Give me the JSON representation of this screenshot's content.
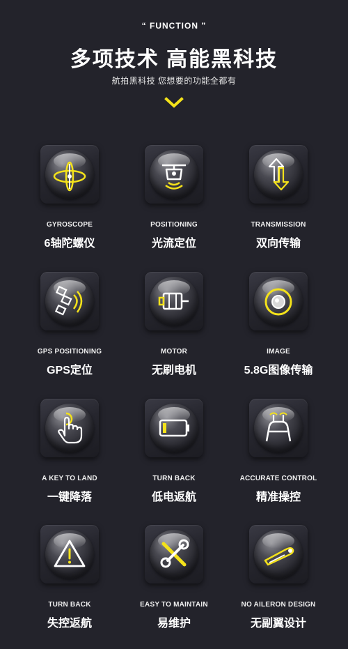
{
  "header": {
    "function_label": "“ FUNCTION ”",
    "title": "多项技术 高能黑科技",
    "subtitle": "航拍黑科技 您想要的功能全都有"
  },
  "colors": {
    "accent": "#f4e21a",
    "background": "#23232b"
  },
  "features": [
    {
      "en": "GYROSCOPE",
      "cn": "6轴陀螺仪",
      "icon": "gyroscope-icon"
    },
    {
      "en": "POSITIONING",
      "cn": "光流定位",
      "icon": "drone-positioning-icon"
    },
    {
      "en": "TRANSMISSION",
      "cn": "双向传输",
      "icon": "transmission-arrows-icon"
    },
    {
      "en": "GPS POSITIONING",
      "cn": "GPS定位",
      "icon": "satellite-icon"
    },
    {
      "en": "MOTOR",
      "cn": "无刷电机",
      "icon": "motor-icon"
    },
    {
      "en": "IMAGE",
      "cn": "5.8G图像传输",
      "icon": "camera-lens-icon"
    },
    {
      "en": "A KEY TO LAND",
      "cn": "一键降落",
      "icon": "hand-press-icon"
    },
    {
      "en": "TURN BACK",
      "cn": "低电返航",
      "icon": "low-battery-icon"
    },
    {
      "en": "ACCURATE CONTROL",
      "cn": "精准操控",
      "icon": "remote-control-icon"
    },
    {
      "en": "TURN BACK",
      "cn": "失控返航",
      "icon": "warning-triangle-icon"
    },
    {
      "en": "EASY TO MAINTAIN",
      "cn": "易维护",
      "icon": "tools-icon"
    },
    {
      "en": "NO AILERON DESIGN",
      "cn": "无副翼设计",
      "icon": "propeller-blade-icon"
    }
  ]
}
